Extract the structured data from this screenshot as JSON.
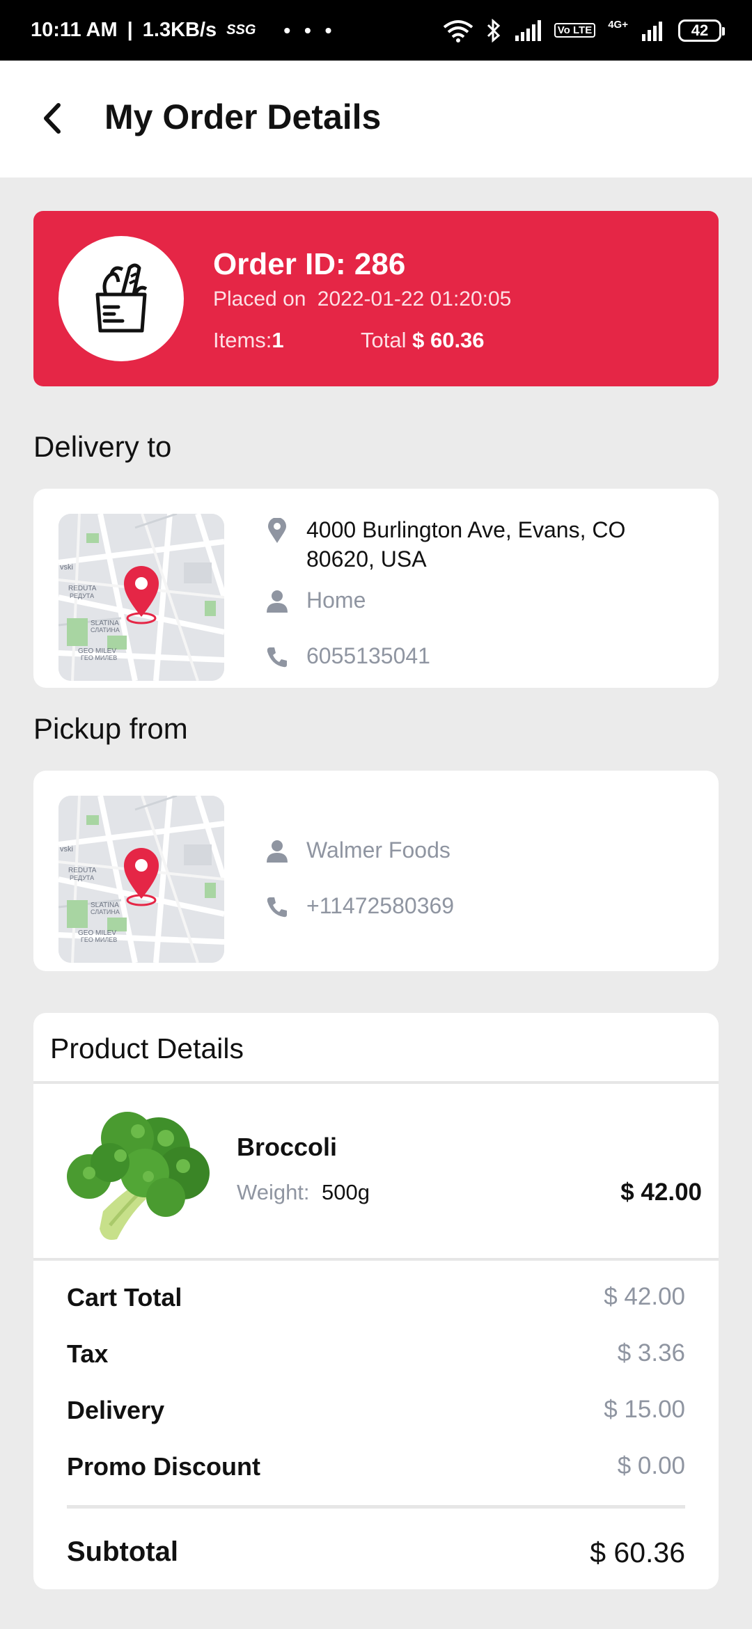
{
  "status_bar": {
    "time": "10:11 AM",
    "speed": "1.3KB/s",
    "dots": "• • •",
    "network_tag": "Vo LTE",
    "network_type": "4G+",
    "battery": "42"
  },
  "header": {
    "title": "My Order Details"
  },
  "order": {
    "id_label": "Order ID: 286",
    "placed_label": "Placed on",
    "placed_date": "2022-01-22 01:20:05",
    "items_label": "Items:",
    "items_count": "1",
    "total_label": "Total",
    "total_value": "$ 60.36"
  },
  "delivery": {
    "section_title": "Delivery to",
    "address": "4000 Burlington Ave, Evans, CO 80620, USA",
    "name": "Home",
    "phone": "6055135041"
  },
  "pickup": {
    "section_title": "Pickup from",
    "name": "Walmer Foods",
    "phone": "+11472580369"
  },
  "map_labels": {
    "l1": "REDUTA",
    "l2": "РЕДУТА",
    "l3": "SLATINA",
    "l4": "СЛАТИНА",
    "l5": "GEO MILEV",
    "l6": "ГЕО МИЛЕВ",
    "l7": "vski"
  },
  "products": {
    "section_title": "Product Details",
    "items": [
      {
        "name": "Broccoli",
        "weight_label": "Weight:",
        "weight": "500g",
        "price": "$ 42.00"
      }
    ]
  },
  "summary": {
    "rows": [
      {
        "label": "Cart Total",
        "value": "$ 42.00"
      },
      {
        "label": "Tax",
        "value": "$ 3.36"
      },
      {
        "label": "Delivery",
        "value": "$ 15.00"
      },
      {
        "label": "Promo Discount",
        "value": "$ 0.00"
      }
    ],
    "subtotal_label": "Subtotal",
    "subtotal_value": "$ 60.36"
  },
  "colors": {
    "accent": "#e52646",
    "background": "#ebebeb",
    "muted_text": "#8f95a1",
    "icon": "#8f95a1"
  },
  "icons": {
    "back": "chevron-left-icon",
    "order": "grocery-bag-icon",
    "address": "location-pin-icon",
    "name": "person-icon",
    "phone": "phone-icon",
    "map_marker": "map-marker-icon"
  }
}
